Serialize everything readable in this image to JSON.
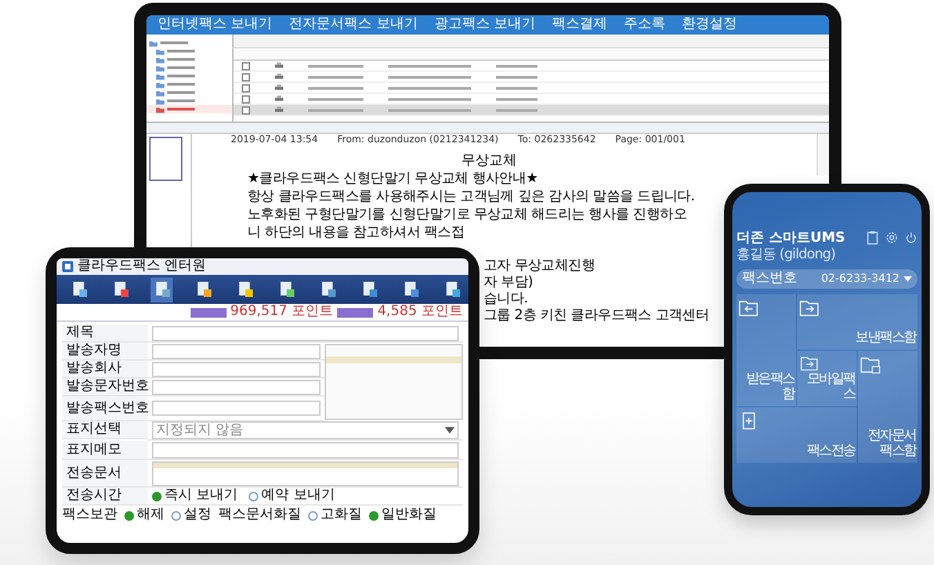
{
  "monitor": {
    "menu": [
      "인터넷팩스 보내기",
      "전자문서팩스 보내기",
      "광고팩스 보내기",
      "팩스결제",
      "주소록",
      "환경설정"
    ],
    "tree_items": [
      {
        "selected": false
      },
      {
        "selected": false
      },
      {
        "selected": false
      },
      {
        "selected": false
      },
      {
        "selected": false
      },
      {
        "selected": false
      },
      {
        "selected": false
      },
      {
        "selected": false
      },
      {
        "selected": true
      }
    ],
    "table_rows": [
      {
        "selected": false
      },
      {
        "selected": false
      },
      {
        "selected": false
      },
      {
        "selected": false
      },
      {
        "selected": true
      }
    ],
    "preview": {
      "date": "2019-07-04 13:54",
      "from": "From: duzonduzon (0212341234)",
      "to": "To: 0262335642",
      "page": "Page: 001/001"
    },
    "document": {
      "title": "무상교체",
      "lines": [
        "★클라우드팩스 신형단말기 무상교체 행사안내★",
        "항상 클라우드팩스를 사용해주시는 고객님께 깊은 감사의 말씀을 드립니다.",
        "노후화된 구형단말기를 신형단말기로 무상교체 해드리는 행사를 진행하오니 하단의 내용을 참고하셔서 팩스접"
      ],
      "fragments": [
        "고자 무상교체진행",
        "자 부담)",
        "습니다.",
        "그룹 2층 키친 클라우드팩스 고객센터"
      ]
    }
  },
  "tablet": {
    "title": "클라우드팩스 엔터원",
    "toolbar": [
      {
        "selected": false
      },
      {
        "selected": false
      },
      {
        "selected": true
      },
      {
        "selected": false
      },
      {
        "selected": false
      },
      {
        "selected": false
      },
      {
        "selected": false
      },
      {
        "selected": false
      },
      {
        "selected": false
      },
      {
        "selected": false
      }
    ],
    "points": [
      "969,517 포인트",
      "4,585 포인트"
    ],
    "form": [
      {
        "kind": "text",
        "label": "제목"
      },
      {
        "kind": "text",
        "label": "발송자명"
      },
      {
        "kind": "text",
        "label": "발송회사"
      },
      {
        "kind": "text",
        "label": "발송문자번호"
      },
      {
        "kind": "fax",
        "label": "발송팩스번호"
      },
      {
        "kind": "select",
        "label": "표지선택",
        "value": "지정되지 않음"
      },
      {
        "kind": "memo",
        "label": "표지메모"
      },
      {
        "kind": "docs",
        "label": "전송문서"
      },
      {
        "kind": "radio",
        "label": "전송시간",
        "options": [
          {
            "label": "즉시 보내기",
            "selected": true
          },
          {
            "label": "예약 보내기",
            "selected": false
          }
        ]
      }
    ],
    "footer": [
      {
        "label": "팩스보관",
        "options": [
          {
            "label": "해제",
            "selected": true
          },
          {
            "label": "설정",
            "selected": false
          }
        ]
      },
      {
        "label": "팩스문서화질",
        "options": [
          {
            "label": "고화질",
            "selected": false
          },
          {
            "label": "일반화질",
            "selected": true
          }
        ]
      }
    ]
  },
  "phone": {
    "app_name": "더존 스마트UMS",
    "user": "홍길동 (gildong)",
    "fax_label": "팩스번호",
    "fax_number": "02-6233-3412",
    "tiles": [
      {
        "kind": "inbox",
        "label": "받은팩스함"
      },
      {
        "kind": "outbox",
        "label": "보낸팩스함"
      },
      {
        "kind": "send",
        "label": "모바일팩스"
      },
      {
        "kind": "new",
        "label": "팩스전송"
      },
      {
        "kind": "secure",
        "label": "전자문서팩스함"
      }
    ]
  }
}
